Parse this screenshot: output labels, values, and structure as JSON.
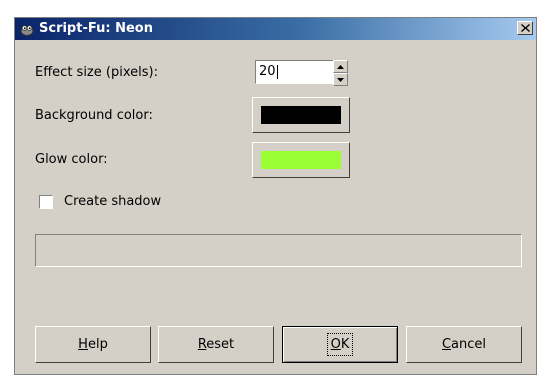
{
  "window": {
    "title": "Script-Fu: Neon"
  },
  "form": {
    "effect_size_label": "Effect size (pixels):",
    "effect_size_value": "20",
    "background_color_label": "Background color:",
    "background_color_value": "#000000",
    "glow_color_label": "Glow color:",
    "glow_color_value": "#99ff33",
    "shadow_label": "Create shadow",
    "shadow_checked": false
  },
  "progress": {
    "fraction": 0
  },
  "buttons": {
    "help": {
      "mnemonic": "H",
      "rest": "elp"
    },
    "reset": {
      "mnemonic": "R",
      "rest": "eset"
    },
    "ok": {
      "mnemonic": "O",
      "rest": "K"
    },
    "cancel": {
      "mnemonic": "C",
      "rest": "ancel"
    }
  },
  "icons": {
    "title": "gimp-wilber-icon",
    "close": "close-icon",
    "spin_up": "spin-up-arrow-icon",
    "spin_down": "spin-down-arrow-icon"
  }
}
